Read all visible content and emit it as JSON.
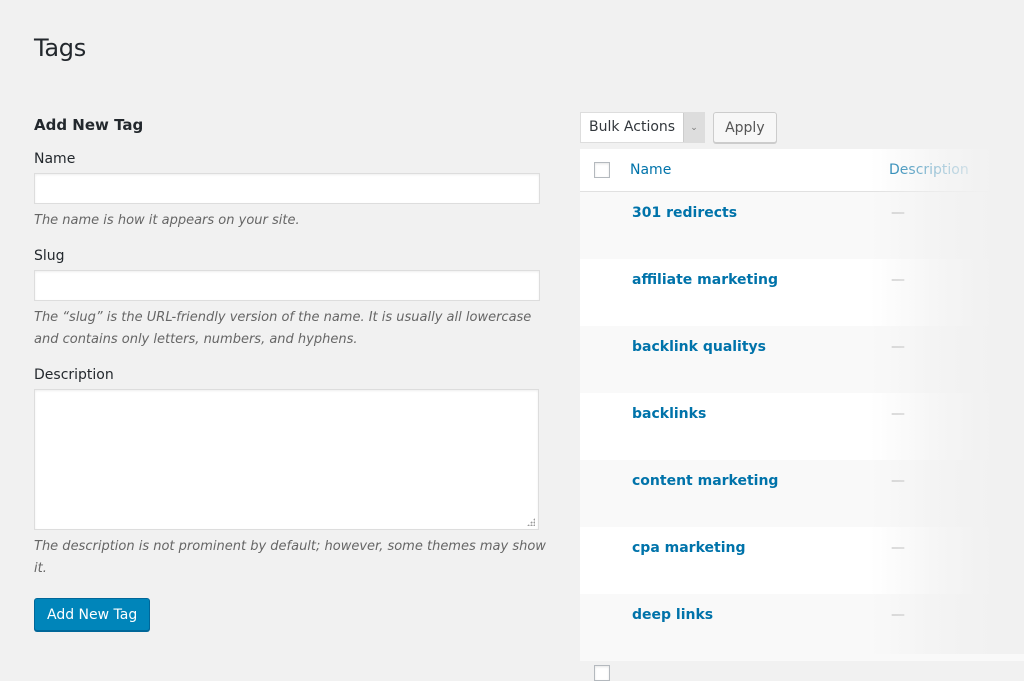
{
  "page": {
    "title": "Tags"
  },
  "add_form": {
    "heading": "Add New Tag",
    "name": {
      "label": "Name",
      "value": "",
      "hint": "The name is how it appears on your site."
    },
    "slug": {
      "label": "Slug",
      "value": "",
      "hint": "The “slug” is the URL-friendly version of the name. It is usually all lowercase and contains only letters, numbers, and hyphens."
    },
    "description": {
      "label": "Description",
      "value": "",
      "hint": "The description is not prominent by default; however, some themes may show it."
    },
    "submit_label": "Add New Tag"
  },
  "bulk": {
    "selected": "Bulk Actions",
    "apply_label": "Apply"
  },
  "table": {
    "columns": [
      "Name",
      "Description"
    ],
    "rows": [
      {
        "name": "301 redirects",
        "description": "—"
      },
      {
        "name": "affiliate marketing",
        "description": "—"
      },
      {
        "name": "backlink qualitys",
        "description": "—"
      },
      {
        "name": "backlinks",
        "description": "—"
      },
      {
        "name": "content marketing",
        "description": "—"
      },
      {
        "name": "cpa marketing",
        "description": "—"
      },
      {
        "name": "deep links",
        "description": "—"
      }
    ]
  },
  "colors": {
    "accent": "#0073aa",
    "primary_button": "#0085ba",
    "background": "#f1f1f1"
  }
}
